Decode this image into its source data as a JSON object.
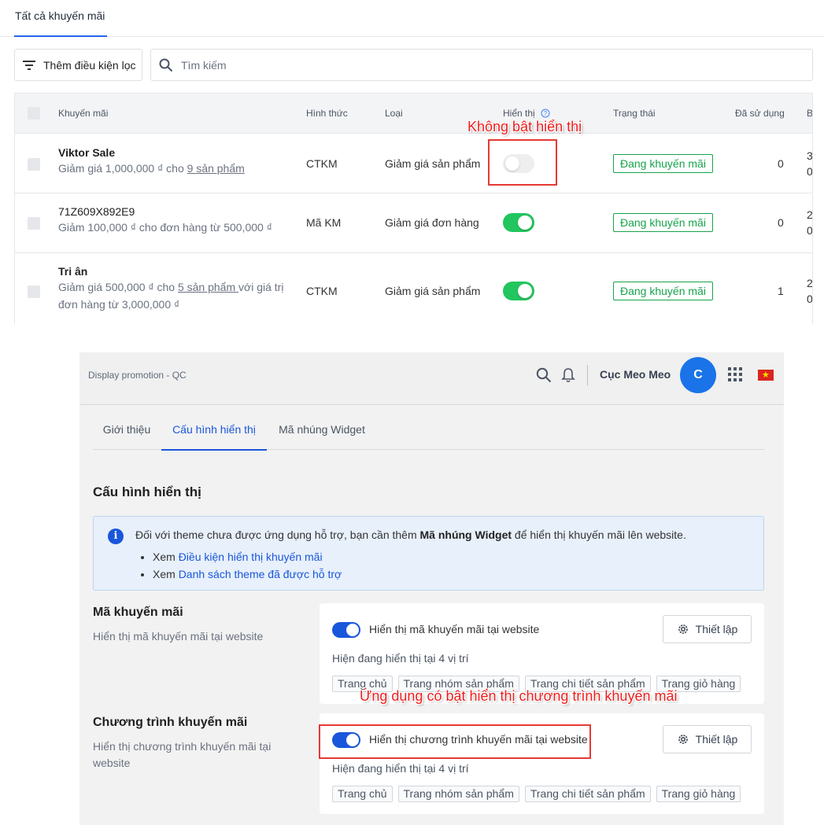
{
  "top": {
    "tab": "Tất cả khuyến mãi",
    "filter_label": "Thêm điều kiện lọc",
    "search_placeholder": "Tìm kiếm",
    "headers": {
      "promotion": "Khuyến mãi",
      "form": "Hình thức",
      "type": "Loại",
      "display": "Hiển thị",
      "status": "Trạng thái",
      "used": "Đã sử dụng",
      "cut": "B"
    },
    "rows": [
      {
        "title": "Viktor Sale",
        "desc_prefix": "Giảm giá 1,000,000 ₫ cho ",
        "desc_link": "9 sản phẩm",
        "desc_suffix": "",
        "form": "CTKM",
        "type": "Giảm giá sản phẩm",
        "display_on": false,
        "status": "Đang khuyến mãi",
        "used": "0",
        "cut1": "3",
        "cut2": "0"
      },
      {
        "title": "71Z609X892E9",
        "desc_prefix": "Giảm 100,000 ₫ cho đơn hàng từ 500,000 ₫",
        "desc_link": "",
        "desc_suffix": "",
        "form": "Mã KM",
        "type": "Giảm giá đơn hàng",
        "display_on": true,
        "status": "Đang khuyến mãi",
        "used": "0",
        "cut1": "2",
        "cut2": "0"
      },
      {
        "title": "Tri ân",
        "desc_prefix": "Giảm giá 500,000 ₫ cho ",
        "desc_link": "5 sản phẩm ",
        "desc_suffix": "với giá trị",
        "desc_line2": "đơn hàng từ 3,000,000 ₫",
        "form": "CTKM",
        "type": "Giảm giá sản phẩm",
        "display_on": true,
        "status": "Đang khuyến mãi",
        "used": "1",
        "cut1": "2",
        "cut2": "0"
      }
    ],
    "annotation": "Không bật hiển thị"
  },
  "bottom": {
    "app_title": "Display promotion - QC",
    "user_name": "Cục Meo Meo",
    "avatar_letter": "C",
    "tabs": [
      "Giới thiệu",
      "Cấu hình hiển thị",
      "Mã nhúng Widget"
    ],
    "section_title": "Cấu hình hiển thị",
    "info": {
      "line_prefix": "Đối với theme chưa được ứng dụng hỗ trợ, bạn cần thêm ",
      "line_bold": "Mã nhúng Widget",
      "line_suffix": " để hiển thị khuyến mãi lên website.",
      "bullet1_prefix": "Xem ",
      "bullet1_link": "Điều kiện hiển thị khuyến mãi",
      "bullet2_prefix": "Xem ",
      "bullet2_link": "Danh sách theme đã được hỗ trợ"
    },
    "groups": [
      {
        "title": "Mã khuyến mãi",
        "desc": "Hiển thị mã khuyến mãi tại website",
        "toggle_label": "Hiển thị mã khuyến mãi tại website",
        "button": "Thiết lập",
        "locations_text": "Hiện đang hiển thị tại 4 vị trí",
        "chips": [
          "Trang chủ",
          "Trang nhóm sản phẩm",
          "Trang chi tiết sản phẩm",
          "Trang giỏ hàng"
        ]
      },
      {
        "title": "Chương trình khuyến mãi",
        "desc": "Hiển thị chương trình khuyến mãi tại website",
        "toggle_label": "Hiển thị chương trình khuyến mãi tại website",
        "button": "Thiết lập",
        "locations_text": "Hiện đang hiển thị tại 4 vị trí",
        "chips": [
          "Trang chủ",
          "Trang nhóm sản phẩm",
          "Trang chi tiết sản phẩm",
          "Trang giỏ hàng"
        ]
      }
    ],
    "annotation": "Ứng dụng có bật hiển thị chương trình khuyến mãi"
  },
  "colors": {
    "accent": "#1a56db",
    "toggle_on_green": "#22c55e",
    "status_green": "#16a34a",
    "annotation_red": "#e53935"
  }
}
